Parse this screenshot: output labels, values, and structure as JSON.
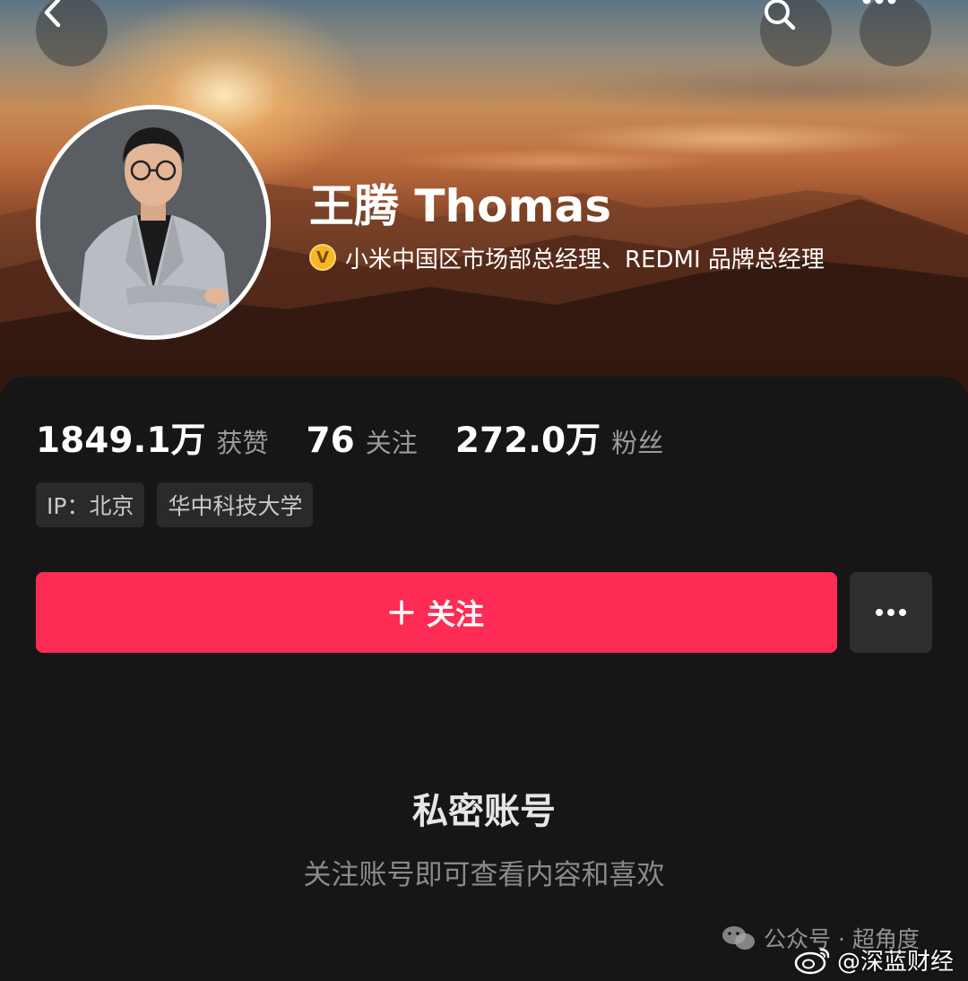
{
  "header": {
    "back_icon": "chevron-left-icon",
    "search_icon": "search-icon",
    "more_icon": "more-horizontal-icon"
  },
  "profile": {
    "name": "王腾 Thomas",
    "verified_badge": "V",
    "verification_text": "小米中国区市场部总经理、REDMI 品牌总经理"
  },
  "stats": [
    {
      "value": "1849.1万",
      "label": "获赞"
    },
    {
      "value": "76",
      "label": "关注"
    },
    {
      "value": "272.0万",
      "label": "粉丝"
    }
  ],
  "tags": [
    "IP：北京",
    "华中科技大学"
  ],
  "actions": {
    "follow_label": "关注",
    "follow_icon": "plus-icon",
    "more_icon": "more-horizontal-icon"
  },
  "private": {
    "title": "私密账号",
    "subtitle": "关注账号即可查看内容和喜欢"
  },
  "watermarks": {
    "wechat_text": "公众号 · 超角度",
    "weibo_text": "@深蓝财经"
  },
  "colors": {
    "accent": "#fe2c55",
    "badge": "#f6b62b",
    "background": "#161616"
  }
}
